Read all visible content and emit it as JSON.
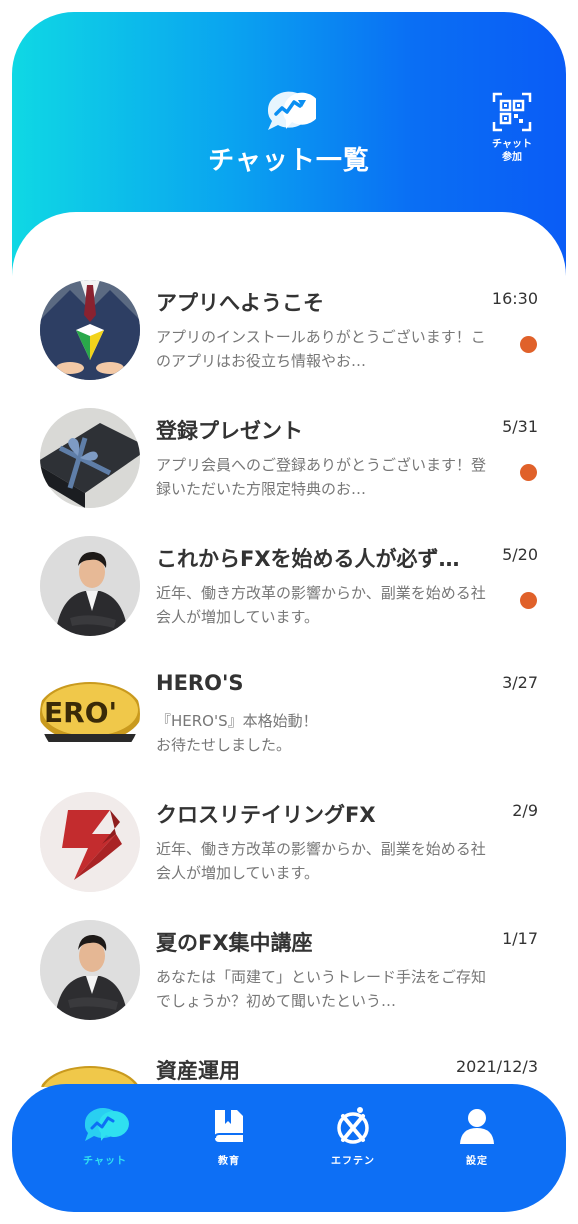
{
  "header": {
    "title": "チャット一覧",
    "qr_label_line1": "チャット",
    "qr_label_line2": "参加",
    "logo_icon": "chat-chart-logo-icon",
    "qr_icon": "qr-code-icon"
  },
  "colors": {
    "gradient_start": "#0fd8e4",
    "gradient_end": "#0a5cf6",
    "nav_background": "#0d6ff5",
    "unread_dot": "#e0612a",
    "active_nav": "#2fe0f0"
  },
  "chats": [
    {
      "title": "アプリへようこそ",
      "time": "16:30",
      "preview": "アプリのインストールありがとうございます！このアプリはお役立ち情報やお…",
      "unread": true
    },
    {
      "title": "登録プレゼント",
      "time": "5/31",
      "preview": "アプリ会員へのご登録ありがとうございます！登録いただいた方限定特典のお…",
      "unread": true
    },
    {
      "title": "これからFXを始める人が必ず…",
      "time": "5/20",
      "preview": "近年、働き方改革の影響からか、副業を始める社会人が増加しています。",
      "unread": true
    },
    {
      "title": "HERO'S",
      "time": "3/27",
      "preview": "『HERO'S』本格始動！\nお待たせしました。",
      "unread": false
    },
    {
      "title": "クロスリテイリングFX",
      "time": "2/9",
      "preview": "近年、働き方改革の影響からか、副業を始める社会人が増加しています。",
      "unread": false
    },
    {
      "title": "夏のFX集中講座",
      "time": "1/17",
      "preview": "あなたは「両建て」というトレード手法をご存知でしょうか？初めて聞いたという…",
      "unread": false
    },
    {
      "title": "資産運用",
      "time": "2021/12/3",
      "preview": "",
      "unread": false
    }
  ],
  "nav": [
    {
      "label": "チャット",
      "icon": "chat-icon",
      "active": true
    },
    {
      "label": "教育",
      "icon": "book-icon",
      "active": false
    },
    {
      "label": "エフテン",
      "icon": "ften-logo-icon",
      "active": false
    },
    {
      "label": "設定",
      "icon": "user-icon",
      "active": false
    }
  ]
}
